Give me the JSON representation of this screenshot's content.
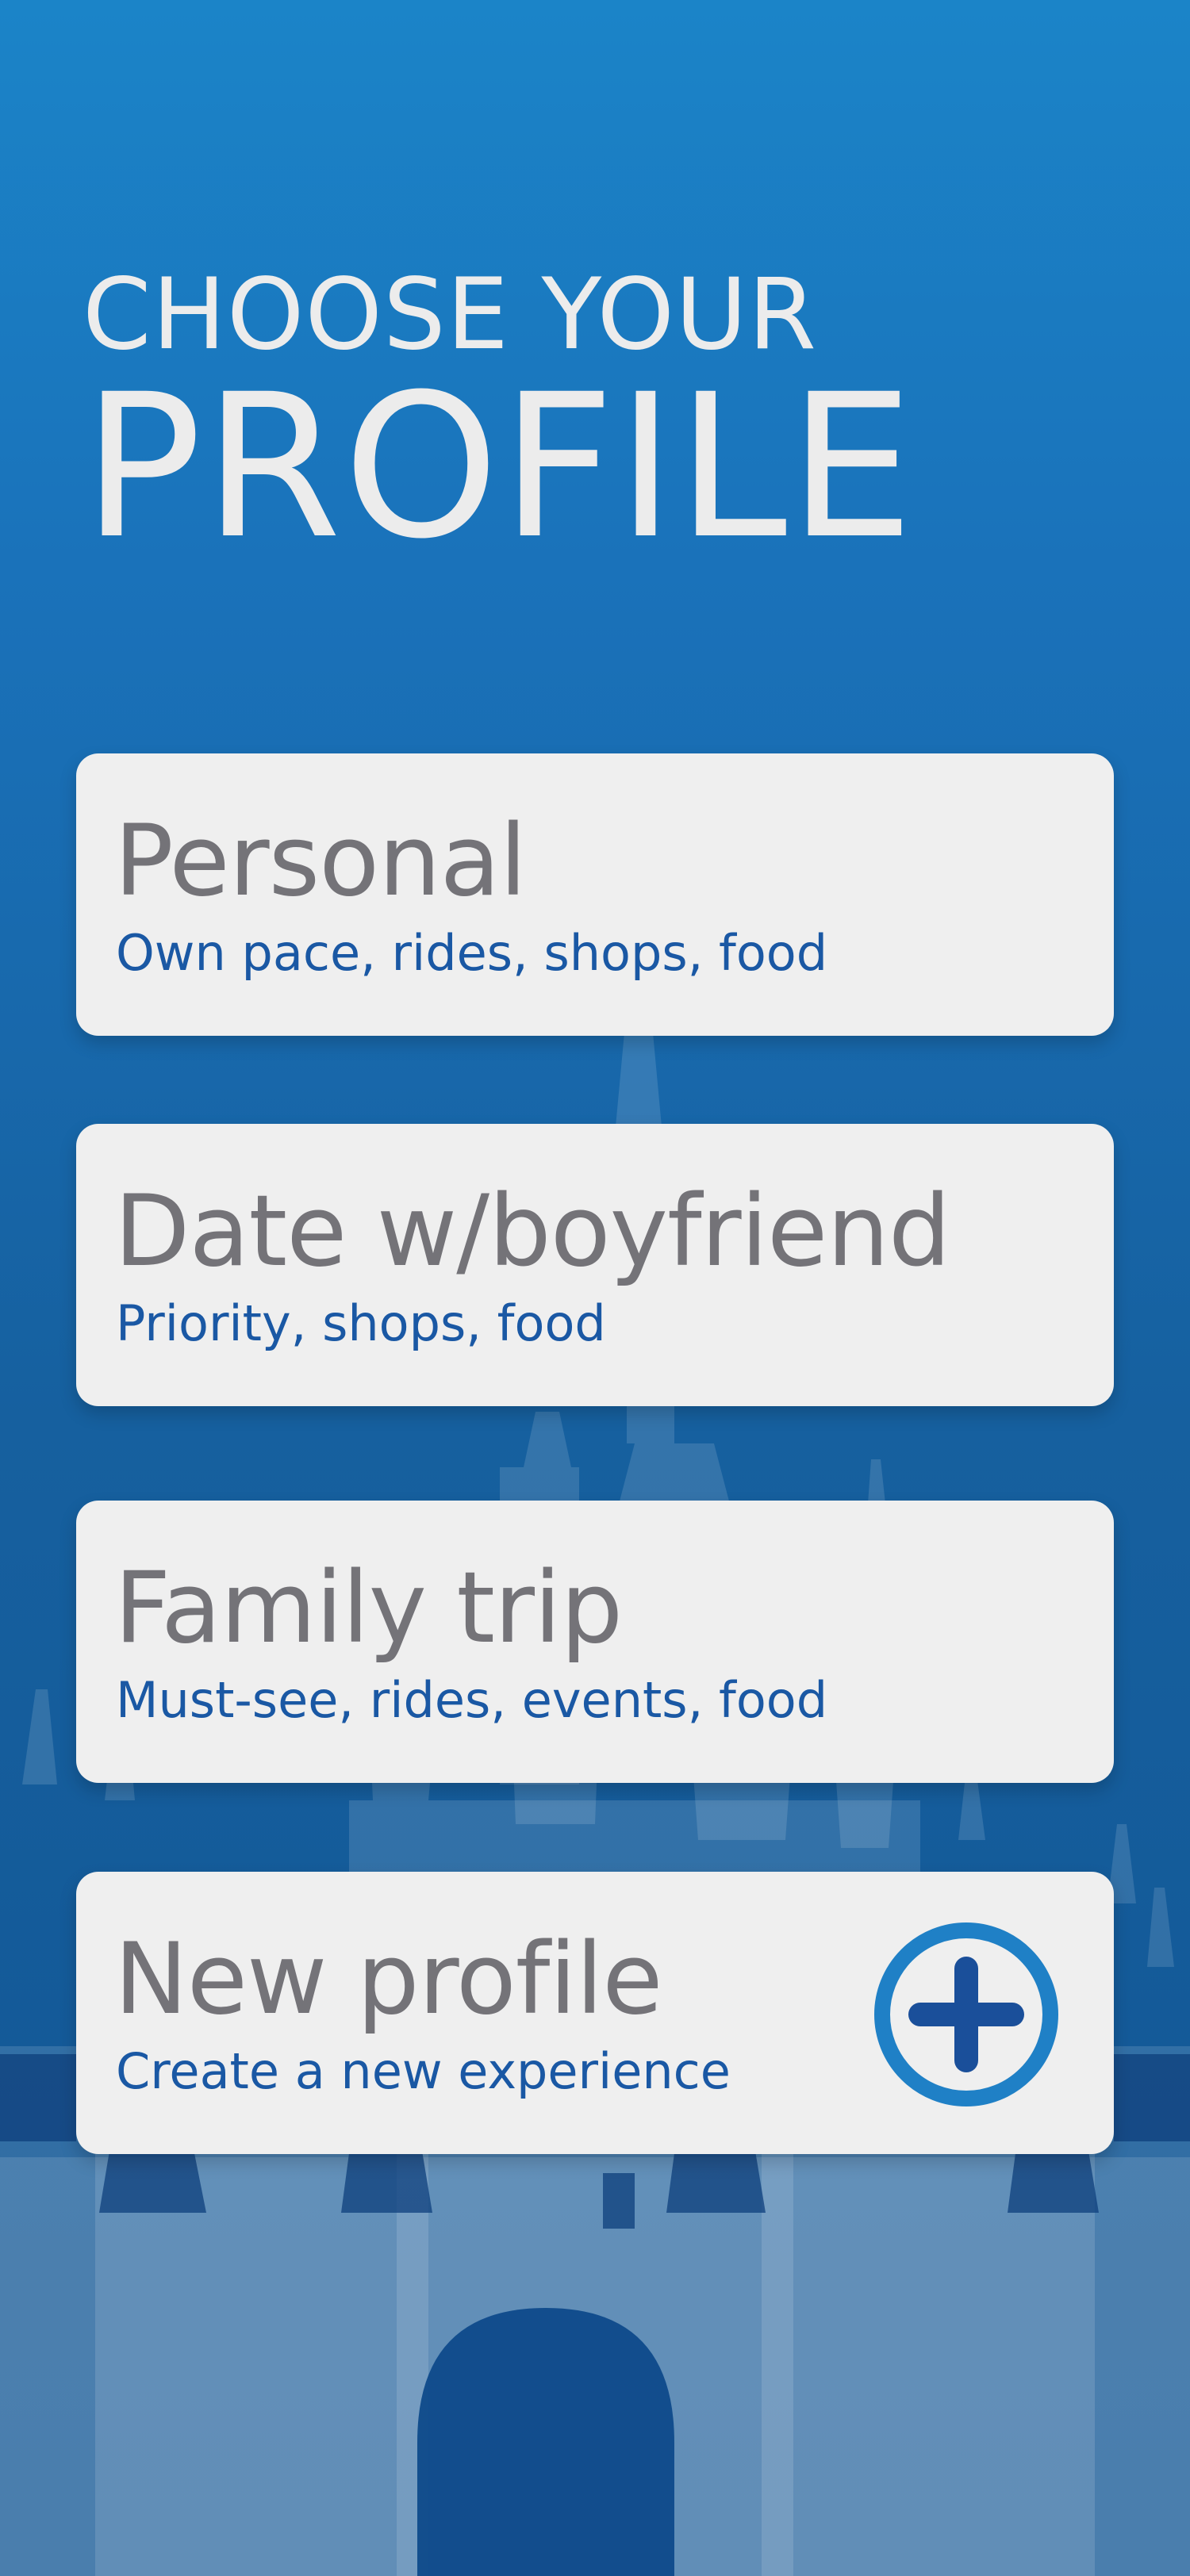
{
  "header": {
    "line1": "CHOOSE YOUR",
    "line2": "PROFILE"
  },
  "profiles": [
    {
      "title": "Personal",
      "description": "Own pace, rides, shops, food"
    },
    {
      "title": "Date w/boyfriend",
      "description": "Priority, shops, food"
    },
    {
      "title": "Family trip",
      "description": "Must-see, rides, events, food"
    }
  ],
  "new_profile": {
    "title": "New profile",
    "description": "Create a new experience",
    "icon": "plus-circle-icon"
  },
  "background": {
    "illustration": "castle-silhouette"
  },
  "colors": {
    "background_top": "#1b84c8",
    "background_bottom": "#125593",
    "heading": "#ececec",
    "card": "#efefef",
    "card_title": "#747378",
    "card_description": "#1a58a4",
    "plus_ring": "#1f80c6",
    "plus_sign": "#1a4f9a"
  }
}
